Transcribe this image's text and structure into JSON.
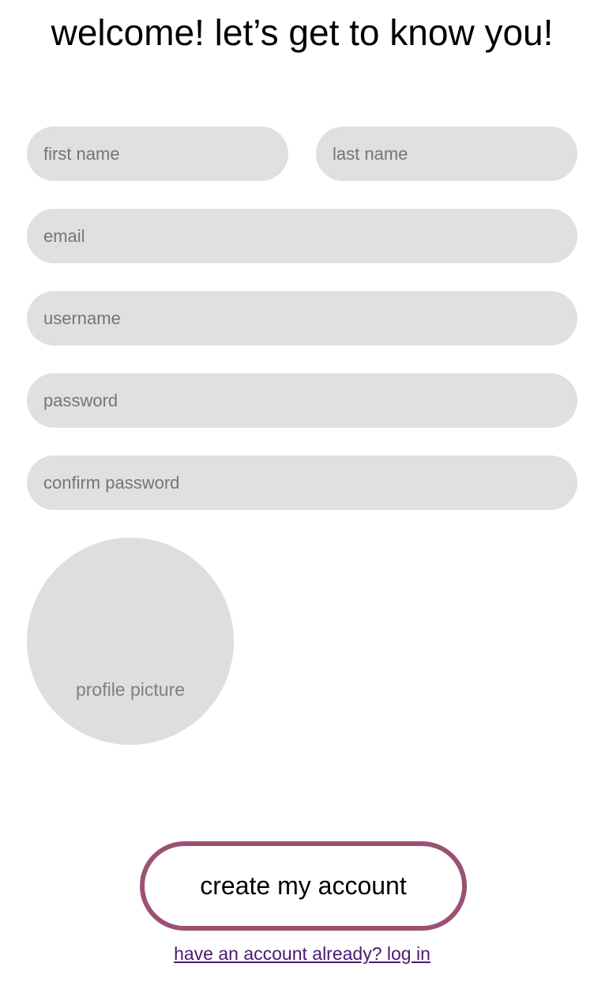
{
  "page": {
    "title": "welcome! let’s get to know you!"
  },
  "form": {
    "first_name_placeholder": "first name",
    "last_name_placeholder": "last name",
    "email_placeholder": "email",
    "username_placeholder": "username",
    "password_placeholder": "password",
    "confirm_password_placeholder": "confirm password",
    "profile_picture_label": "profile picture"
  },
  "actions": {
    "create_label": "create my account",
    "login_link_label": "have an account already? log in"
  },
  "colors": {
    "field_background": "#e0e0e0",
    "button_border": "#9a5274",
    "link": "#4b1a6e"
  }
}
